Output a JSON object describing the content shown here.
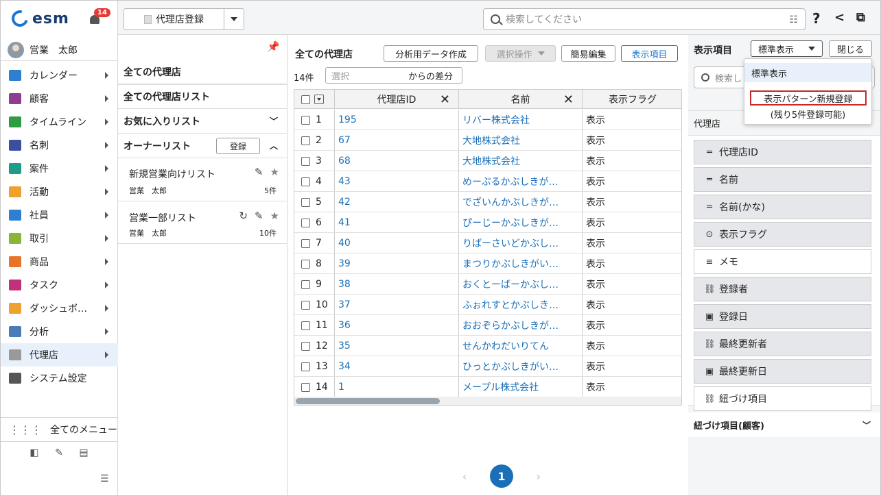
{
  "app": {
    "logo_text": "esm",
    "notifications": "14",
    "user_name": "営業　太郎"
  },
  "sidebar": {
    "items": [
      {
        "label": "カレンダー",
        "color": "#2e7fd1"
      },
      {
        "label": "顧客",
        "color": "#8e3d8f"
      },
      {
        "label": "タイムライン",
        "color": "#2e9d3f"
      },
      {
        "label": "名刺",
        "color": "#3b4f9e"
      },
      {
        "label": "案件",
        "color": "#1f9b88"
      },
      {
        "label": "活動",
        "color": "#f0a030"
      },
      {
        "label": "社員",
        "color": "#2e7fd1"
      },
      {
        "label": "取引",
        "color": "#8ab43a"
      },
      {
        "label": "商品",
        "color": "#e8742a"
      },
      {
        "label": "タスク",
        "color": "#c2307a"
      },
      {
        "label": "ダッシュボ…",
        "color": "#f0a030"
      },
      {
        "label": "分析",
        "color": "#4a7db8"
      },
      {
        "label": "代理店",
        "color": "#999999"
      },
      {
        "label": "システム設定",
        "color": "#555555"
      }
    ],
    "all_menu": "全てのメニュー"
  },
  "topbar": {
    "register_label": "代理店登録",
    "search_placeholder": "検索してください"
  },
  "list_panel": {
    "all_agencies": "全ての代理店",
    "all_agency_lists": "全ての代理店リスト",
    "favorites": "お気に入りリスト",
    "owner_list": "オーナーリスト",
    "register_btn": "登録",
    "lists": [
      {
        "name": "新規営業向けリスト",
        "owner": "営業　太郎",
        "count": "5件"
      },
      {
        "name": "営業一部リスト",
        "owner": "営業　太郎",
        "count": "10件"
      }
    ]
  },
  "main": {
    "title": "全ての代理店",
    "btn_analysis": "分析用データ作成",
    "btn_select": "選択操作",
    "btn_edit": "簡易編集",
    "btn_display": "表示項目",
    "count": "14件",
    "diff_placeholder": "選択",
    "diff_suffix": "からの差分",
    "columns": [
      "代理店ID",
      "名前",
      "表示フラグ"
    ],
    "rows": [
      {
        "n": "1",
        "id": "195",
        "name": "リバー株式会社",
        "flag": "表示"
      },
      {
        "n": "2",
        "id": "67",
        "name": "大地株式会社",
        "flag": "表示"
      },
      {
        "n": "3",
        "id": "68",
        "name": "大地株式会社",
        "flag": "表示"
      },
      {
        "n": "4",
        "id": "43",
        "name": "めーぷるかぶしきが…",
        "flag": "表示"
      },
      {
        "n": "5",
        "id": "42",
        "name": "でざいんかぶしきが…",
        "flag": "表示"
      },
      {
        "n": "6",
        "id": "41",
        "name": "ぴーじーかぶしきが…",
        "flag": "表示"
      },
      {
        "n": "7",
        "id": "40",
        "name": "りばーさいどかぶし…",
        "flag": "表示"
      },
      {
        "n": "8",
        "id": "39",
        "name": "まつりかぶしきがい…",
        "flag": "表示"
      },
      {
        "n": "9",
        "id": "38",
        "name": "おくとーばーかぶし…",
        "flag": "表示"
      },
      {
        "n": "10",
        "id": "37",
        "name": "ふぉれすとかぶしき…",
        "flag": "表示"
      },
      {
        "n": "11",
        "id": "36",
        "name": "おおぞらかぶしきが…",
        "flag": "表示"
      },
      {
        "n": "12",
        "id": "35",
        "name": "せんかわだいりてん",
        "flag": "表示"
      },
      {
        "n": "13",
        "id": "34",
        "name": "ひっとかぶしきがい…",
        "flag": "表示"
      },
      {
        "n": "14",
        "id": "1",
        "name": "メープル株式会社",
        "flag": "表示"
      }
    ],
    "page": "1"
  },
  "right_panel": {
    "title": "表示項目",
    "pattern_label": "標準表示",
    "close_label": "閉じる",
    "search_placeholder": "検索し",
    "section_agency": "代理店",
    "fields": [
      {
        "label": "代理店ID",
        "icon": "text-icon",
        "glyph": "═",
        "selected": true
      },
      {
        "label": "名前",
        "icon": "text-icon",
        "glyph": "═",
        "selected": true
      },
      {
        "label": "名前(かな)",
        "icon": "text-icon",
        "glyph": "═",
        "selected": true
      },
      {
        "label": "表示フラグ",
        "icon": "select-icon",
        "glyph": "⊙",
        "selected": true
      },
      {
        "label": "メモ",
        "icon": "memo-icon",
        "glyph": "≡",
        "selected": false
      },
      {
        "label": "登録者",
        "icon": "link-icon",
        "glyph": "⛓",
        "selected": true
      },
      {
        "label": "登録日",
        "icon": "calendar-icon",
        "glyph": "▣",
        "selected": true
      },
      {
        "label": "最終更新者",
        "icon": "link-icon",
        "glyph": "⛓",
        "selected": true
      },
      {
        "label": "最終更新日",
        "icon": "calendar-icon",
        "glyph": "▣",
        "selected": true
      },
      {
        "label": "紐づけ項目",
        "icon": "link-icon",
        "glyph": "⛓",
        "selected": false
      }
    ],
    "section_linked": "紐づけ項目(顧客)"
  },
  "dropdown": {
    "item_standard": "標準表示",
    "item_new": "表示パターン新規登録",
    "note": "(残り5件登録可能)"
  }
}
